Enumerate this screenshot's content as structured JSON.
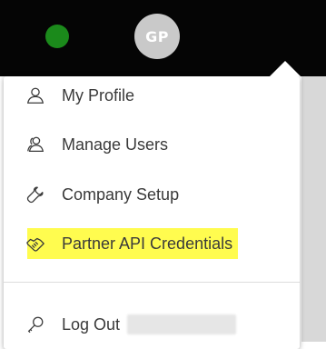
{
  "header": {
    "status_color": "#1b8a1b",
    "avatar_initials": "GP"
  },
  "menu": {
    "items": [
      {
        "label": "My Profile",
        "icon": "user-icon"
      },
      {
        "label": "Manage Users",
        "icon": "users-icon"
      },
      {
        "label": "Company Setup",
        "icon": "wrench-icon"
      },
      {
        "label": "Partner API Credentials",
        "icon": "handshake-icon",
        "highlighted": true
      }
    ],
    "logout": {
      "label": "Log Out",
      "icon": "key-icon"
    }
  },
  "colors": {
    "highlight": "#fffc4f",
    "topbar": "#050505"
  }
}
